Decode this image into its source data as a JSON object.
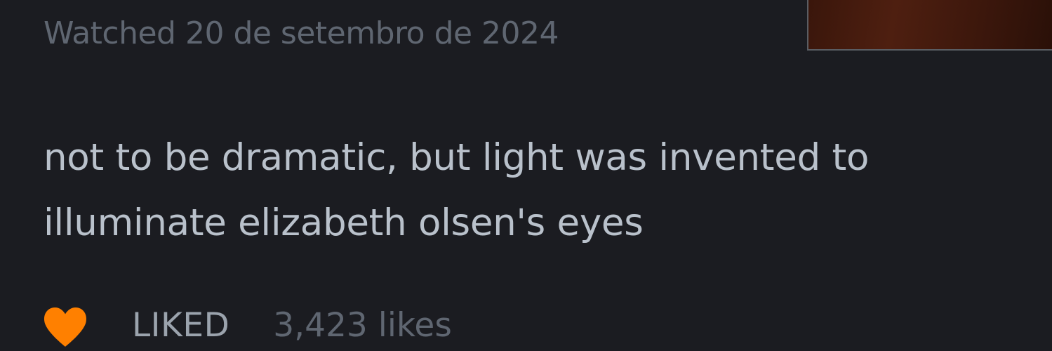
{
  "review": {
    "watched": "Watched 20 de setembro de 2024",
    "text": "not to be dramatic, but light was invented to illuminate elizabeth olsen's eyes"
  },
  "actions": {
    "like_icon": "heart-icon",
    "like_color": "#ff8000",
    "liked_label": "LIKED",
    "likes_count": "3,423 likes"
  },
  "colors": {
    "background": "#1b1c21",
    "text_primary": "#b9c1cb",
    "text_muted": "#5f6671"
  }
}
